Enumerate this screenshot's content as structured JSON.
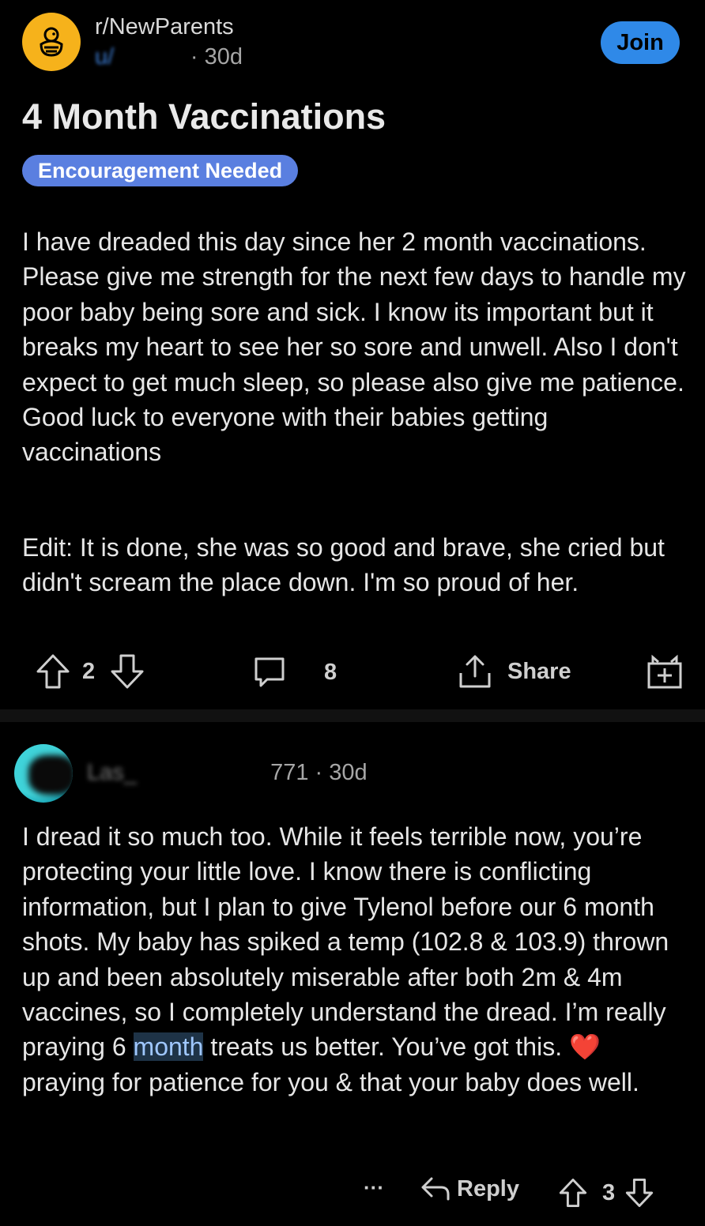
{
  "post": {
    "subreddit": "r/NewParents",
    "author": "u/",
    "age": "30d",
    "join_label": "Join",
    "title": "4 Month Vaccinations",
    "flair": "Encouragement Needed",
    "paragraphs": [
      "I have dreaded this day since her 2 month vaccinations. Please give me strength for the next few days to handle my poor baby being sore and sick. I know its important but it breaks my heart to see her so sore and unwell. Also I don't expect to get much sleep, so please also give me patience. Good luck to everyone with their babies getting vaccinations",
      "Edit: It is done, she was so good and brave, she cried but didn't scream the place down. I'm so proud of her."
    ],
    "votes": "2",
    "comments": "8",
    "share_label": "Share"
  },
  "comment": {
    "author": "771",
    "age": "30d",
    "text_before": "I dread it so much too.  While it  feels terrible now, you’re protecting your little love. I know there is conflicting information, but I plan to give Tylenol before our 6 month shots. My baby has spiked a temp (102.8 & 103.9) thrown up and been absolutely miserable after both 2m & 4m vaccines, so I completely understand the dread. I’m really praying 6 ",
    "highlighted": "month",
    "text_after": " treats us better. You’ve got this. ",
    "emoji": "❤️",
    "text_end": " praying for patience for you & that your baby does well.",
    "more_label": "···",
    "reply_label": "Reply",
    "votes": "3"
  },
  "colors": {
    "accent": "#2f89e8",
    "flair_bg": "#5a7fe0",
    "subreddit_icon_bg": "#f6b21b",
    "background": "#000000"
  },
  "icons": [
    "subreddit-duck-icon",
    "upvote-icon",
    "downvote-icon",
    "comment-icon",
    "share-icon",
    "award-icon",
    "more-icon",
    "reply-icon"
  ]
}
